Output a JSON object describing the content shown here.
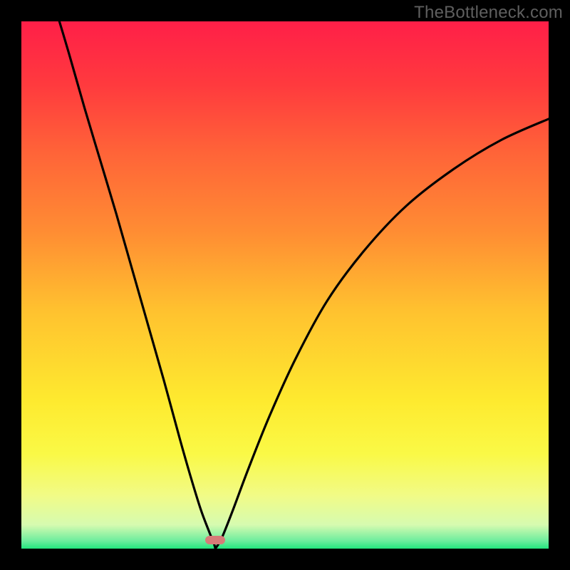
{
  "watermark": "TheBottleneck.com",
  "frame": {
    "outer_size": 800,
    "inset": 30,
    "plot_size": 740,
    "border_color": "#000000"
  },
  "gradient": {
    "stops": [
      {
        "offset": 0.0,
        "color": "#ff1f48"
      },
      {
        "offset": 0.12,
        "color": "#ff3a3e"
      },
      {
        "offset": 0.25,
        "color": "#ff6438"
      },
      {
        "offset": 0.4,
        "color": "#ff8d33"
      },
      {
        "offset": 0.55,
        "color": "#ffc22f"
      },
      {
        "offset": 0.72,
        "color": "#feea2f"
      },
      {
        "offset": 0.82,
        "color": "#faf946"
      },
      {
        "offset": 0.9,
        "color": "#f1fb87"
      },
      {
        "offset": 0.955,
        "color": "#d6fbb0"
      },
      {
        "offset": 0.985,
        "color": "#6eed9e"
      },
      {
        "offset": 1.0,
        "color": "#23e57e"
      }
    ]
  },
  "marker": {
    "x_frac": 0.368,
    "y_frac": 0.984,
    "color": "#d77b78"
  },
  "chart_data": {
    "type": "line",
    "title": "",
    "xlabel": "",
    "ylabel": "",
    "xlim": [
      0,
      1
    ],
    "ylim": [
      0,
      1
    ],
    "vertex_x": 0.368,
    "series": [
      {
        "name": "left-branch",
        "x": [
          0.06,
          0.09,
          0.12,
          0.15,
          0.18,
          0.21,
          0.24,
          0.27,
          0.3,
          0.32,
          0.34,
          0.355,
          0.365,
          0.368
        ],
        "y": [
          1.04,
          0.94,
          0.835,
          0.735,
          0.635,
          0.53,
          0.425,
          0.32,
          0.21,
          0.14,
          0.075,
          0.035,
          0.01,
          0.0
        ]
      },
      {
        "name": "right-branch",
        "x": [
          0.368,
          0.38,
          0.4,
          0.43,
          0.47,
          0.52,
          0.58,
          0.65,
          0.73,
          0.82,
          0.91,
          1.0
        ],
        "y": [
          0.0,
          0.02,
          0.07,
          0.15,
          0.25,
          0.36,
          0.47,
          0.565,
          0.65,
          0.72,
          0.775,
          0.815
        ]
      }
    ]
  }
}
